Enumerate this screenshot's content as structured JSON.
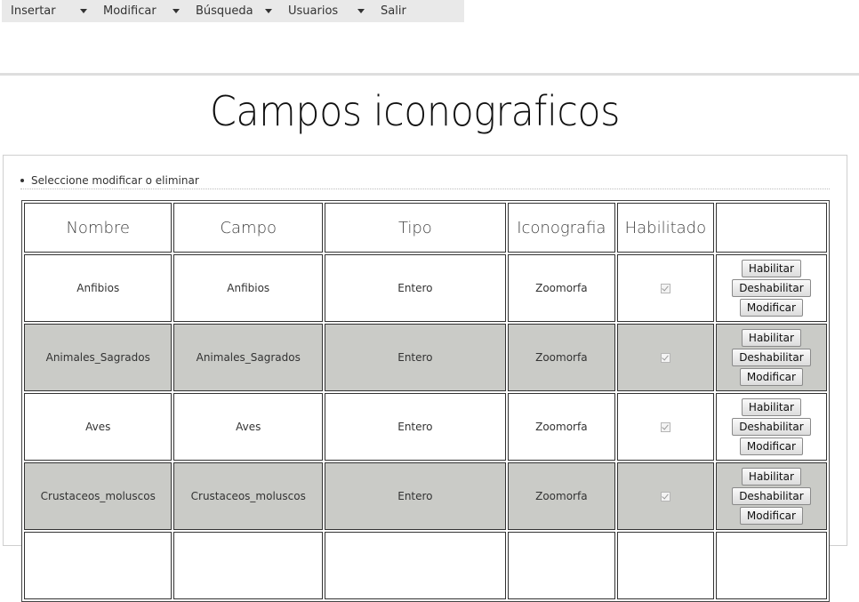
{
  "menu": {
    "items": [
      {
        "label": "Insertar"
      },
      {
        "label": "Modificar"
      },
      {
        "label": "Búsqueda"
      },
      {
        "label": "Usuarios"
      },
      {
        "label": "Salir"
      }
    ]
  },
  "page": {
    "title": "Campos iconograficos",
    "instruction": "Seleccione modificar o eliminar"
  },
  "table": {
    "headers": [
      "Nombre",
      "Campo",
      "Tipo",
      "Iconografia",
      "Habilitado",
      ""
    ],
    "buttons": {
      "enable": "Habilitar",
      "disable": "Deshabilitar",
      "modify": "Modificar"
    },
    "rows": [
      {
        "nombre": "Anfibios",
        "campo": "Anfibios",
        "tipo": "Entero",
        "iconografia": "Zoomorfa",
        "habilitado": true
      },
      {
        "nombre": "Animales_Sagrados",
        "campo": "Animales_Sagrados",
        "tipo": "Entero",
        "iconografia": "Zoomorfa",
        "habilitado": true
      },
      {
        "nombre": "Aves",
        "campo": "Aves",
        "tipo": "Entero",
        "iconografia": "Zoomorfa",
        "habilitado": true
      },
      {
        "nombre": "Crustaceos_moluscos",
        "campo": "Crustaceos_moluscos",
        "tipo": "Entero",
        "iconografia": "Zoomorfa",
        "habilitado": true
      }
    ]
  }
}
